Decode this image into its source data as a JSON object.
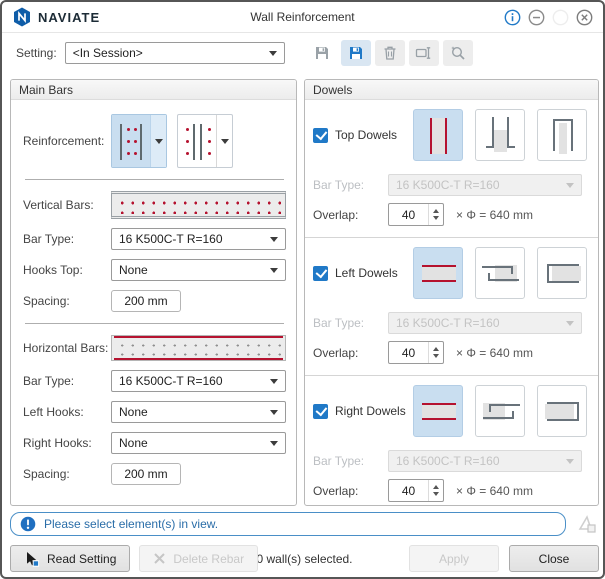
{
  "window": {
    "brand": "NAVIATE",
    "title": "Wall Reinforcement",
    "controls": [
      "info",
      "minimize",
      "maximize-disabled",
      "close"
    ]
  },
  "setting": {
    "label": "Setting:",
    "value": "<In Session>",
    "toolbar_icons": [
      "save",
      "save-highlighted",
      "delete",
      "rename",
      "preview"
    ]
  },
  "main_bars": {
    "title": "Main Bars",
    "reinforcement_label": "Reinforcement:",
    "reinforcement_options": [
      "bars-inside-faces",
      "bars-outside-faces"
    ],
    "vertical_bars_label": "Vertical Bars:",
    "vertical_bar_type_label": "Bar Type:",
    "vertical_bar_type": "16 K500C-T R=160",
    "hooks_top_label": "Hooks Top:",
    "hooks_top_value": "None",
    "vertical_spacing_label": "Spacing:",
    "vertical_spacing_value": "200 mm",
    "horizontal_bars_label": "Horizontal Bars:",
    "horizontal_bar_type_label": "Bar Type:",
    "horizontal_bar_type": "16 K500C-T R=160",
    "left_hooks_label": "Left Hooks:",
    "left_hooks_value": "None",
    "right_hooks_label": "Right Hooks:",
    "right_hooks_value": "None",
    "horizontal_spacing_label": "Spacing:",
    "horizontal_spacing_value": "200 mm"
  },
  "dowels": {
    "title": "Dowels",
    "top": {
      "label": "Top Dowels",
      "checked": true,
      "shape_options": [
        "straight",
        "bent",
        "u-shape"
      ],
      "selected_shape": "straight",
      "bar_type_label": "Bar Type:",
      "bar_type": "16 K500C-T R=160",
      "overlap_label": "Overlap:",
      "overlap": "40",
      "formula": "× Φ = 640 mm"
    },
    "left": {
      "label": "Left Dowels",
      "checked": true,
      "shape_options": [
        "straight",
        "bent",
        "u-shape"
      ],
      "selected_shape": "straight",
      "bar_type_label": "Bar Type:",
      "bar_type": "16 K500C-T R=160",
      "overlap_label": "Overlap:",
      "overlap": "40",
      "formula": "× Φ = 640 mm"
    },
    "right": {
      "label": "Right Dowels",
      "checked": true,
      "shape_options": [
        "straight",
        "bent",
        "u-shape"
      ],
      "selected_shape": "straight",
      "bar_type_label": "Bar Type:",
      "bar_type": "16 K500C-T R=160",
      "overlap_label": "Overlap:",
      "overlap": "40",
      "formula": "× Φ = 640 mm"
    }
  },
  "status": {
    "message": "Please select element(s) in view."
  },
  "footer": {
    "read_setting_label": "Read Setting",
    "delete_rebar_label": "Delete Rebar",
    "selection_text": "0 wall(s) selected.",
    "apply_label": "Apply",
    "close_label": "Close"
  },
  "colors": {
    "accent_blue": "#2079c7",
    "selected_bg": "#c9def0",
    "rebar_red": "#b5122f",
    "status_text": "#2a6da8"
  }
}
